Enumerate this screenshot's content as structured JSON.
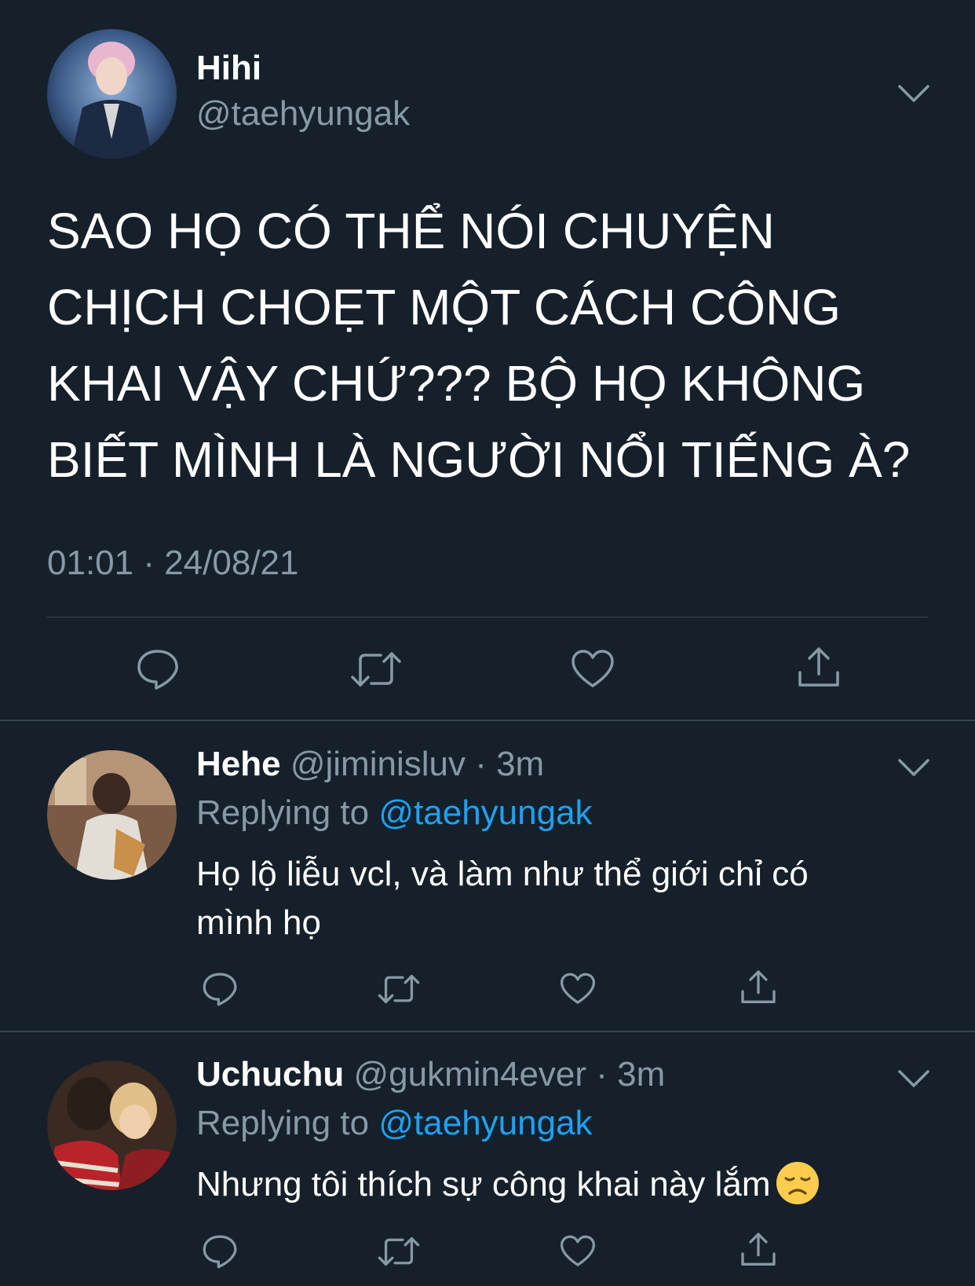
{
  "main_tweet": {
    "name": "Hihi",
    "handle": "@taehyungak",
    "text_lines": [
      "SAO HỌ CÓ THỂ NÓI CHUYỆN",
      "CHỊCH CHOẸT MỘT CÁCH CÔNG",
      "KHAI VẬY CHỨ??? BỘ HỌ KHÔNG",
      "BIẾT MÌNH LÀ NGƯỜI NỔI TIẾNG À?"
    ],
    "timestamp": "01:01 · 24/08/21"
  },
  "replies": [
    {
      "name": "Hehe",
      "handle": "@jiminisluv",
      "time": "· 3m",
      "replying_prefix": "Replying to",
      "replying_to": "@taehyungak",
      "body_lines": [
        "Họ lộ liễu vcl, và làm như thể giới chỉ có",
        "mình họ"
      ],
      "emoji": ""
    },
    {
      "name": "Uchuchu",
      "handle": "@gukmin4ever",
      "time": "· 3m",
      "replying_prefix": "Replying to",
      "replying_to": "@taehyungak",
      "body_lines": [
        "Nhưng tôi thích sự công khai này lắm"
      ],
      "emoji": "disappointed-face"
    }
  ],
  "icons": {
    "reply": "speech-bubble-icon",
    "retweet": "retweet-icon",
    "like": "heart-icon",
    "share": "share-icon",
    "more": "chevron-down-icon"
  },
  "colors": {
    "background": "#15202b",
    "text_primary": "#ffffff",
    "text_secondary": "#8899a6",
    "link": "#1da1f2",
    "divider": "#38444d",
    "icon": "#8899a6"
  }
}
